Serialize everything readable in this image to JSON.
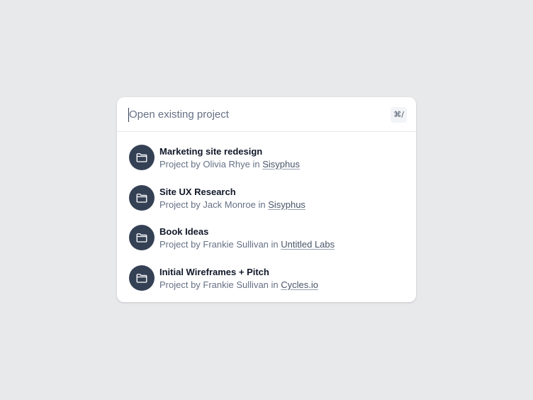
{
  "search": {
    "placeholder": "Open existing project",
    "value": "",
    "shortcut": "⌘/"
  },
  "projects": [
    {
      "title": "Marketing site redesign",
      "prefix": "Project by Olivia Rhye in ",
      "workspace": "Sisyphus",
      "icon": "folder-icon"
    },
    {
      "title": "Site UX Research",
      "prefix": "Project by Jack Monroe in ",
      "workspace": "Sisyphus",
      "icon": "folder-icon"
    },
    {
      "title": "Book Ideas",
      "prefix": "Project by Frankie Sullivan in ",
      "workspace": "Untitled Labs",
      "icon": "folder-icon"
    },
    {
      "title": "Initial Wireframes + Pitch",
      "prefix": "Project by Frankie Sullivan in ",
      "workspace": "Cycles.io",
      "icon": "folder-icon"
    }
  ],
  "colors": {
    "background": "#e8e9eb",
    "avatar": "#344054",
    "title": "#101828",
    "subtitle": "#667085"
  }
}
